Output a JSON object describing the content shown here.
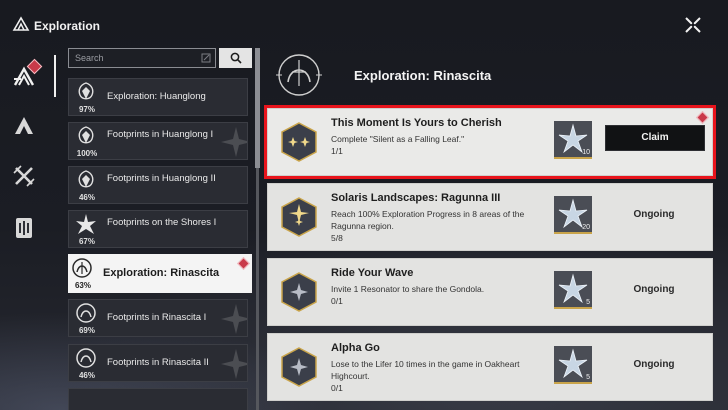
{
  "app": {
    "title": "Exploration"
  },
  "search": {
    "placeholder": "Search"
  },
  "areas": [
    {
      "name": "Exploration: Huanglong",
      "percent": "97%"
    },
    {
      "name": "Footprints in Huanglong I",
      "percent": "100%"
    },
    {
      "name": "Footprints in Huanglong II",
      "percent": "46%"
    },
    {
      "name": "Footprints on the Shores I",
      "percent": "67%"
    },
    {
      "name": "Exploration: Rinascita",
      "percent": "63%",
      "selected": true
    },
    {
      "name": "Footprints in Rinascita I",
      "percent": "69%"
    },
    {
      "name": "Footprints in Rinascita II",
      "percent": "46%"
    }
  ],
  "panel": {
    "title": "Exploration: Rinascita"
  },
  "tasks": [
    {
      "title": "This Moment Is Yours to Cherish",
      "description": "Complete \"Silent as a Falling Leaf.\"",
      "progress": "1/1",
      "reward_count": "10",
      "status": "Claim"
    },
    {
      "title": "Solaris Landscapes: Ragunna III",
      "description": "Reach 100% Exploration Progress in 8 areas of the Ragunna region.",
      "progress": "5/8",
      "reward_count": "20",
      "status": "Ongoing"
    },
    {
      "title": "Ride Your Wave",
      "description": "Invite 1 Resonator to share the Gondola.",
      "progress": "0/1",
      "reward_count": "5",
      "status": "Ongoing"
    },
    {
      "title": "Alpha Go",
      "description": "Lose to the Lifer 10 times in the game in Oakheart Highcourt.",
      "progress": "0/1",
      "reward_count": "5",
      "status": "Ongoing"
    }
  ],
  "colors": {
    "highlight": "#e8141c",
    "badge": "#c93a4a",
    "card": "#e3e3e1"
  }
}
